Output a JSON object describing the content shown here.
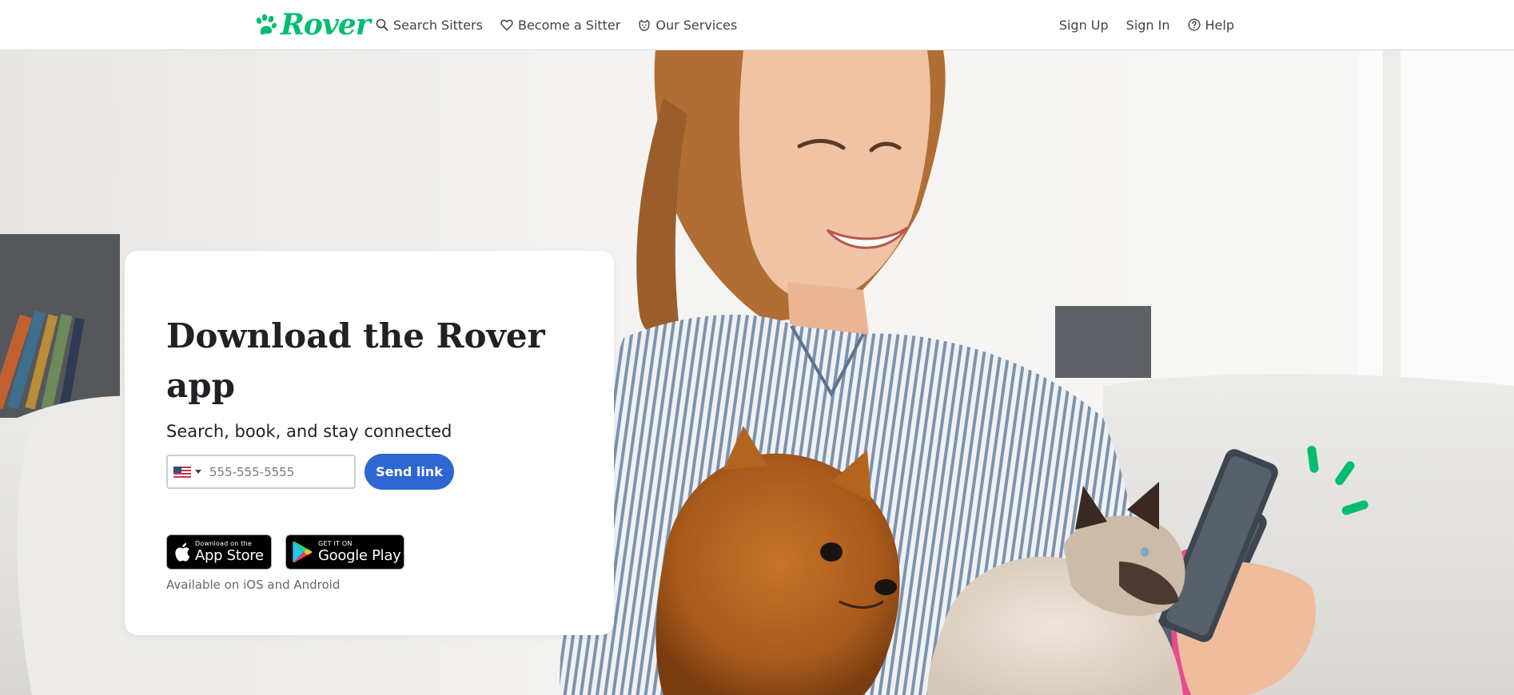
{
  "header": {
    "logo": {
      "text": "Rover",
      "icon": "paw-icon",
      "color": "#00bd70"
    },
    "nav_left": [
      {
        "label": "Search Sitters",
        "icon": "search-icon"
      },
      {
        "label": "Become a Sitter",
        "icon": "heart-icon"
      },
      {
        "label": "Our Services",
        "icon": "dog-icon"
      }
    ],
    "nav_right": [
      {
        "label": "Sign Up"
      },
      {
        "label": "Sign In"
      },
      {
        "label": "Help",
        "icon": "help-circle-icon"
      }
    ]
  },
  "hero": {
    "title": "Download the Rover app",
    "subtitle": "Search, book, and stay connected",
    "phone": {
      "country_flag": "us-flag-icon",
      "placeholder": "555-555-5555",
      "value": ""
    },
    "send_button": "Send link",
    "badges": {
      "app_store": {
        "small": "Download on the",
        "big": "App Store",
        "icon": "apple-icon"
      },
      "google_play": {
        "small": "GET IT ON",
        "big": "Google Play",
        "icon": "google-play-icon"
      }
    },
    "availability": "Available on iOS and Android"
  },
  "colors": {
    "brand_green": "#00bd70",
    "button_blue": "#2e67d1",
    "text_dark": "#1f2124",
    "text_muted": "#62686e"
  }
}
